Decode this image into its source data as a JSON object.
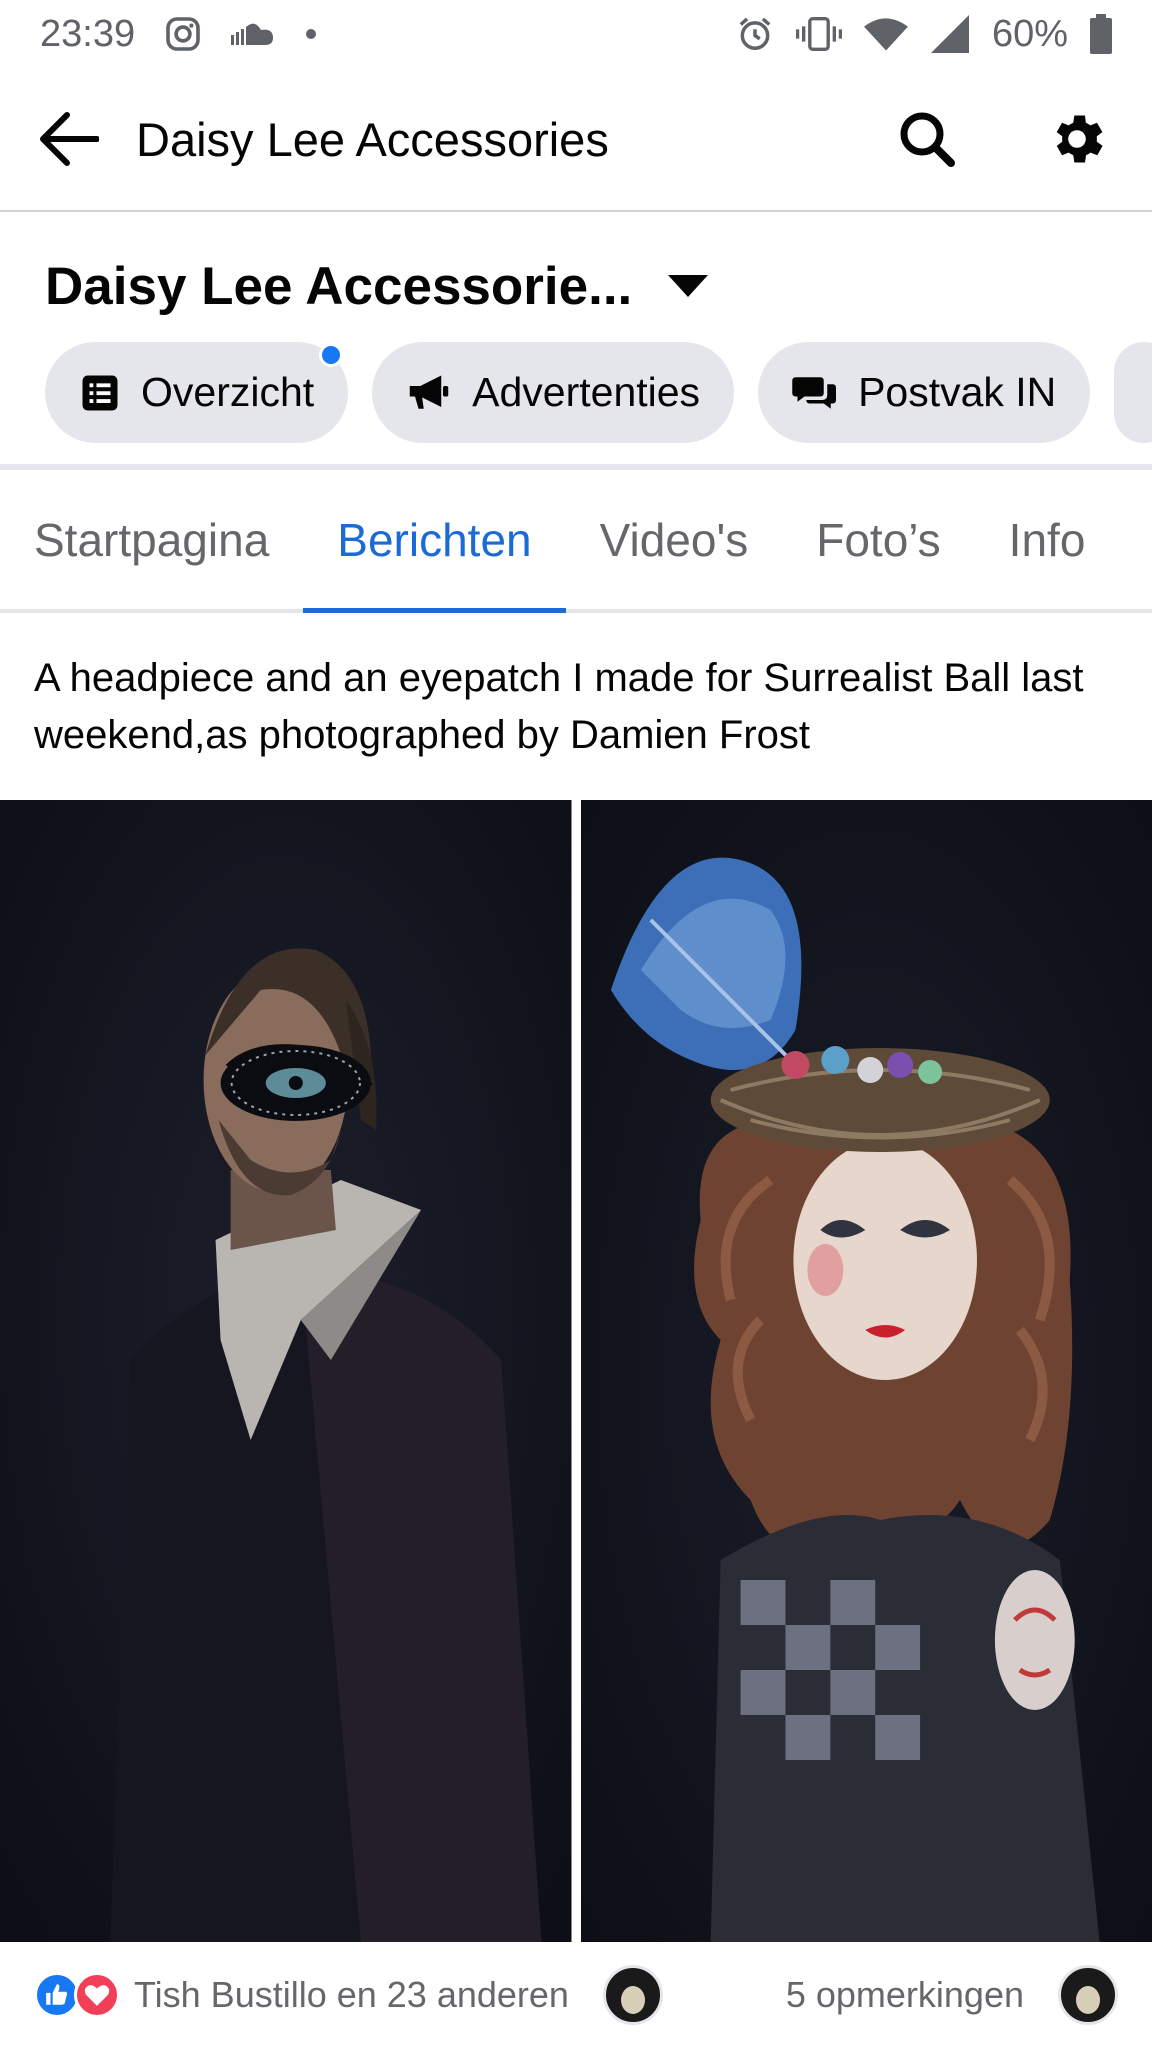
{
  "status_bar": {
    "time": "23:39",
    "battery": "60%",
    "icons": [
      "instagram-icon",
      "soundcloud-icon",
      "dot-icon",
      "alarm-icon",
      "vibrate-icon",
      "wifi-icon",
      "signal-icon",
      "battery-icon"
    ]
  },
  "header": {
    "title": "Daisy Lee Accessories",
    "back_icon": "arrow-left-icon",
    "search_icon": "search-icon",
    "settings_icon": "gear-icon"
  },
  "page": {
    "name": "Daisy Lee Accessorie...",
    "pills": [
      {
        "label": "Overzicht",
        "icon": "list-icon",
        "has_dot": true
      },
      {
        "label": "Advertenties",
        "icon": "megaphone-icon",
        "has_dot": false
      },
      {
        "label": "Postvak IN",
        "icon": "chat-icon",
        "has_dot": false
      }
    ]
  },
  "tabs": [
    {
      "label": "Startpagina",
      "active": false
    },
    {
      "label": "Berichten",
      "active": true
    },
    {
      "label": "Video's",
      "active": false
    },
    {
      "label": "Foto’s",
      "active": false
    },
    {
      "label": "Info",
      "active": false
    }
  ],
  "post": {
    "text": "A headpiece and an eyepatch I made for Surrealist Ball last weekend,as photographed by Damien Frost"
  },
  "reactions": {
    "names": "Tish Bustillo en 23 anderen",
    "comments": "5 opmerkingen"
  },
  "colors": {
    "accent": "#1b6ad6",
    "pill_bg": "#e4e6eb",
    "muted_text": "#65676b",
    "photo_bg": "#12141c"
  }
}
